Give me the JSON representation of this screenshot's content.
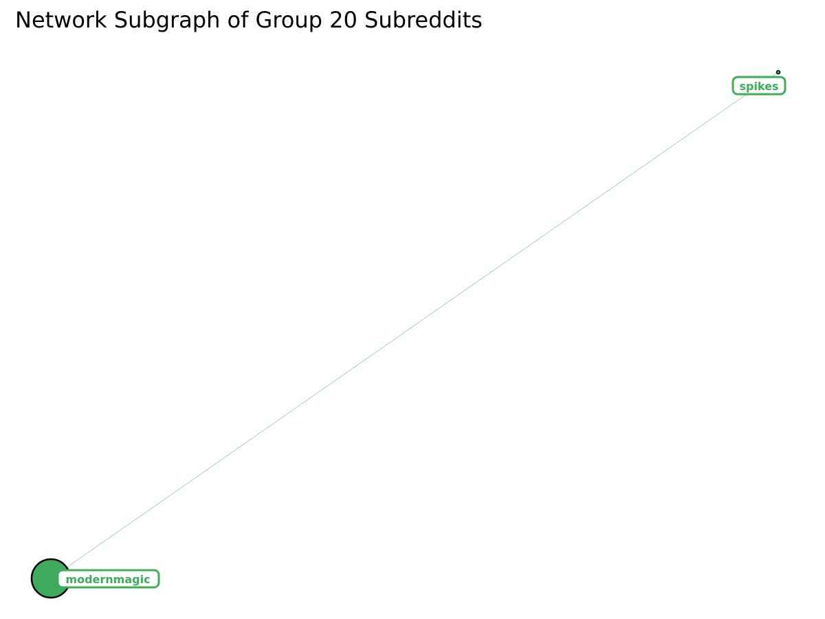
{
  "title": "Network Subgraph of Group 20 Subreddits",
  "colors": {
    "node_fill": "#41ab5d",
    "node_stroke": "#000000",
    "edge": "#41ab5d",
    "label_text": "#41ab5d",
    "label_border": "#41ab5d",
    "label_bg": "#ffffff"
  },
  "nodes": [
    {
      "id": "modernmagic",
      "label": "modernmagic"
    },
    {
      "id": "spikes",
      "label": "spikes"
    }
  ],
  "edges": [
    {
      "source": "modernmagic",
      "target": "spikes"
    }
  ]
}
